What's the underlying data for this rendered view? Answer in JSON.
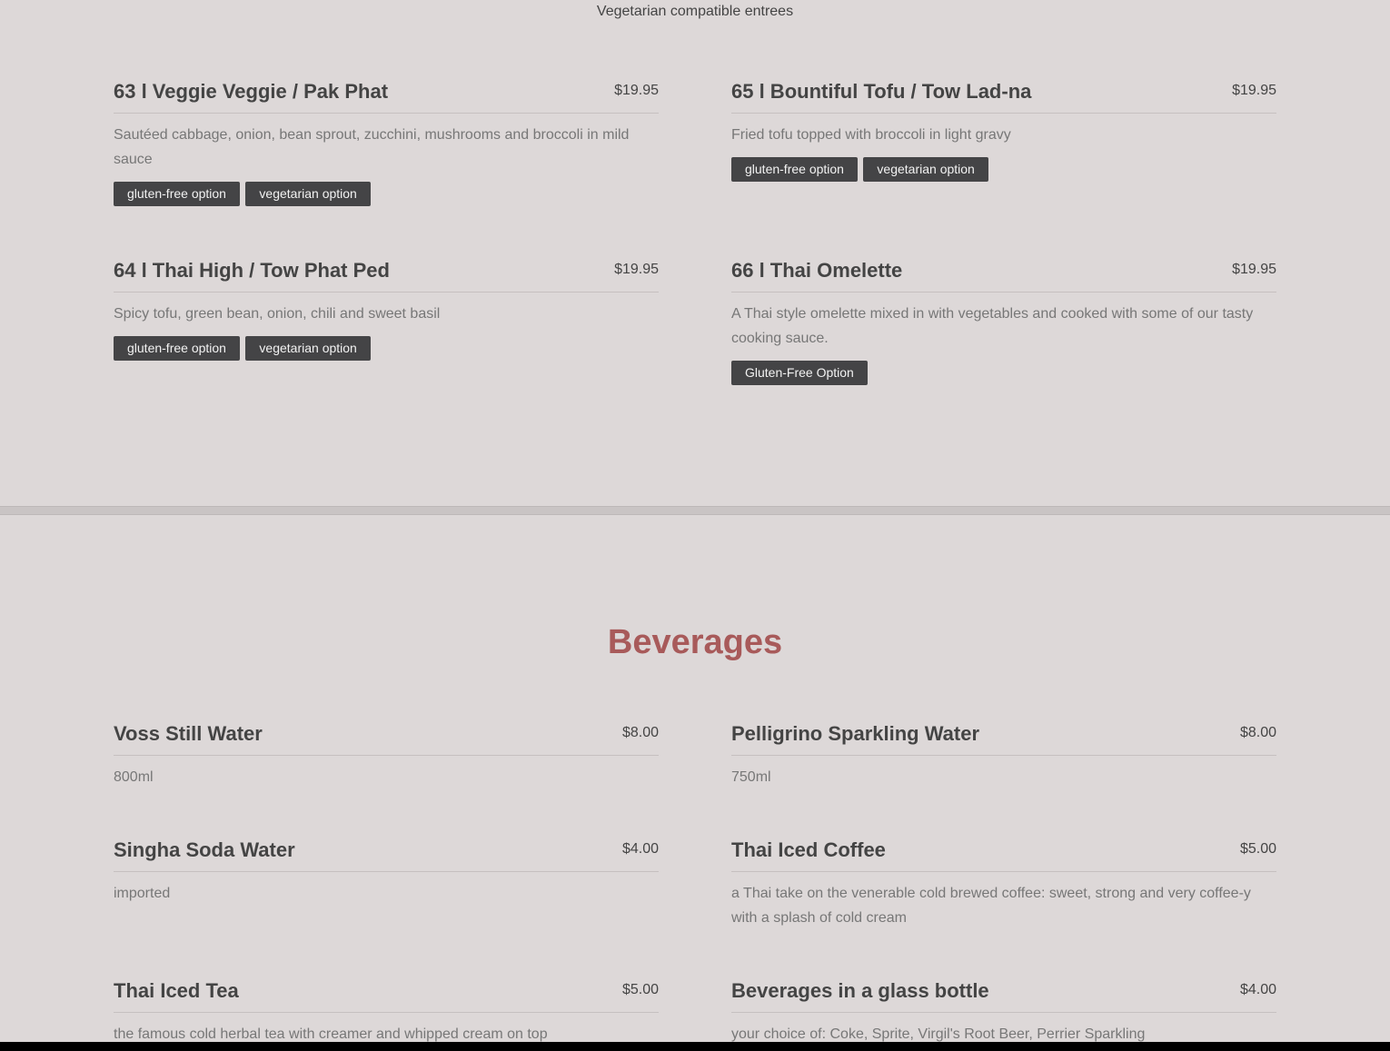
{
  "entrees": {
    "subtitle": "Vegetarian compatible entrees",
    "items": [
      {
        "name": "63 l Veggie Veggie / Pak Phat",
        "price": "$19.95",
        "description": "Sautéed cabbage, onion, bean sprout, zucchini, mushrooms and broccoli in mild sauce",
        "tags": [
          "gluten-free option",
          "vegetarian option"
        ]
      },
      {
        "name": "65 l Bountiful Tofu / Tow Lad-na",
        "price": "$19.95",
        "description": "Fried tofu topped with broccoli in light gravy",
        "tags": [
          "gluten-free option",
          "vegetarian option"
        ]
      },
      {
        "name": "64 l Thai High / Tow Phat Ped",
        "price": "$19.95",
        "description": "Spicy tofu, green bean, onion, chili and sweet basil",
        "tags": [
          "gluten-free option",
          "vegetarian option"
        ]
      },
      {
        "name": "66 l Thai Omelette",
        "price": "$19.95",
        "description": "A Thai style omelette mixed in with vegetables and cooked with some of our tasty cooking sauce.",
        "tags": [
          "Gluten-Free Option"
        ]
      }
    ]
  },
  "beverages": {
    "title": "Beverages",
    "items": [
      {
        "name": "Voss Still Water",
        "price": "$8.00",
        "description": "800ml"
      },
      {
        "name": "Pelligrino Sparkling Water",
        "price": "$8.00",
        "description": "750ml"
      },
      {
        "name": "Singha Soda Water",
        "price": "$4.00",
        "description": "imported"
      },
      {
        "name": "Thai Iced Coffee",
        "price": "$5.00",
        "description": "a Thai take on the venerable cold brewed coffee: sweet, strong and very coffee-y with a splash of cold cream"
      },
      {
        "name": "Thai Iced Tea",
        "price": "$5.00",
        "description": "the famous cold herbal tea with creamer and whipped cream on top"
      },
      {
        "name": "Beverages in a glass bottle",
        "price": "$4.00",
        "description": "your choice of: Coke, Sprite, Virgil's Root Beer, Perrier Sparkling"
      }
    ]
  },
  "colors": {
    "background": "#ddd8d8",
    "accent": "#a85a5a",
    "tag_background": "#444446"
  }
}
